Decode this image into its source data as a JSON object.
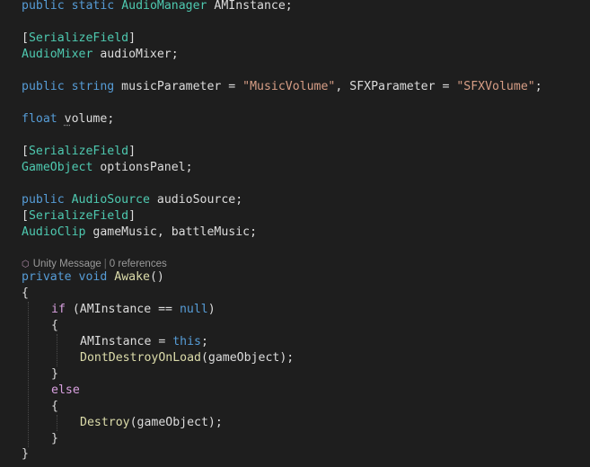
{
  "editor": {
    "codelens": {
      "icon": "unity-message-icon",
      "message": "Unity Message",
      "separator": "|",
      "references": "0 references"
    },
    "lines": {
      "l1": {
        "kw1": "public",
        "kw2": "static",
        "type": "AudioManager",
        "name": " AMInstance;"
      },
      "l3": {
        "open": "[",
        "attr": "SerializeField",
        "close": "]"
      },
      "l4": {
        "type": "AudioMixer",
        "name": " audioMixer;"
      },
      "l6": {
        "kw1": "public",
        "kw2": "string",
        "p1": " musicParameter = ",
        "s1": "\"MusicVolume\"",
        "p2": ", SFXParameter = ",
        "s2": "\"SFXVolume\"",
        "p3": ";"
      },
      "l8": {
        "kw": "float",
        "name_a": "v",
        "name_b": "olume",
        "end": ";"
      },
      "l10": {
        "open": "[",
        "attr": "SerializeField",
        "close": "]"
      },
      "l11": {
        "type": "GameObject",
        "name": " optionsPanel;"
      },
      "l13": {
        "kw": "public",
        "type": "AudioSource",
        "name": " audioSource;"
      },
      "l14": {
        "open": "[",
        "attr": "SerializeField",
        "close": "]"
      },
      "l15": {
        "type": "AudioClip",
        "name": " gameMusic, battleMusic;"
      },
      "l17": {
        "kw1": "private",
        "kw2": "void",
        "method": "Awake",
        "end": "()"
      },
      "l18": {
        "text": "{"
      },
      "l19": {
        "kw": "if",
        "p1": " (AMInstance == ",
        "kw_null": "null",
        "p2": ")"
      },
      "l20": {
        "text": "{"
      },
      "l21": {
        "p1": "AMInstance = ",
        "kw_this": "this",
        "p2": ";"
      },
      "l22": {
        "method": "DontDestroyOnLoad",
        "p1": "(gameObject);"
      },
      "l23": {
        "text": "}"
      },
      "l24": {
        "kw": "else"
      },
      "l25": {
        "text": "{"
      },
      "l26": {
        "method": "Destroy",
        "p1": "(gameObject);"
      },
      "l27": {
        "text": "}"
      },
      "l28": {
        "text": "}"
      }
    }
  }
}
